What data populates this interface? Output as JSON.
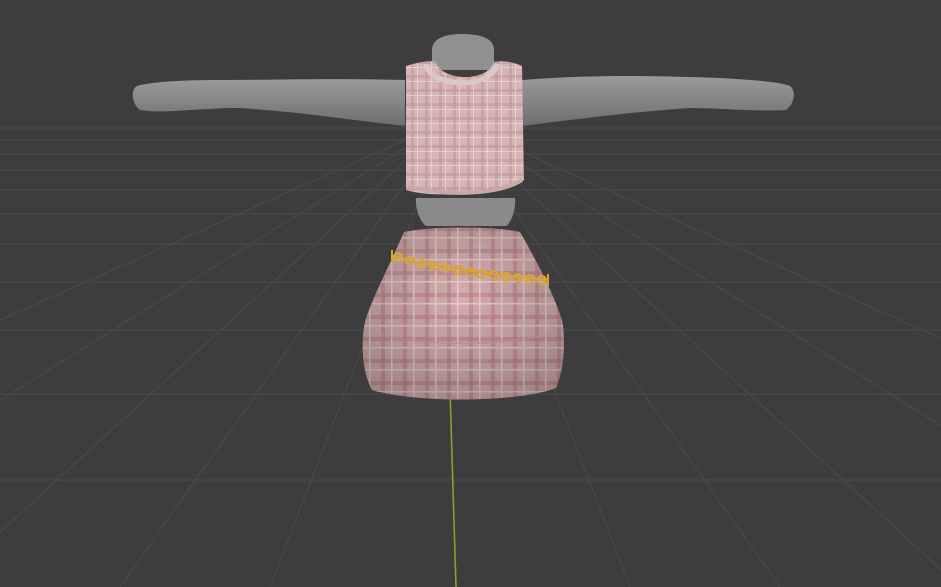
{
  "viewport": {
    "background": "#3d3d3d",
    "grid_color": "#4a4a4a",
    "y_axis_color": "#7fa626"
  },
  "model": {
    "body_color": "#8e8e8e",
    "top_color": "#d7b5b5",
    "top_plaid_color": "#c08c8f",
    "skirt_color": "#d2a9ab",
    "skirt_plaid_color": "#b57b80",
    "chain_color": "#d9a531"
  }
}
